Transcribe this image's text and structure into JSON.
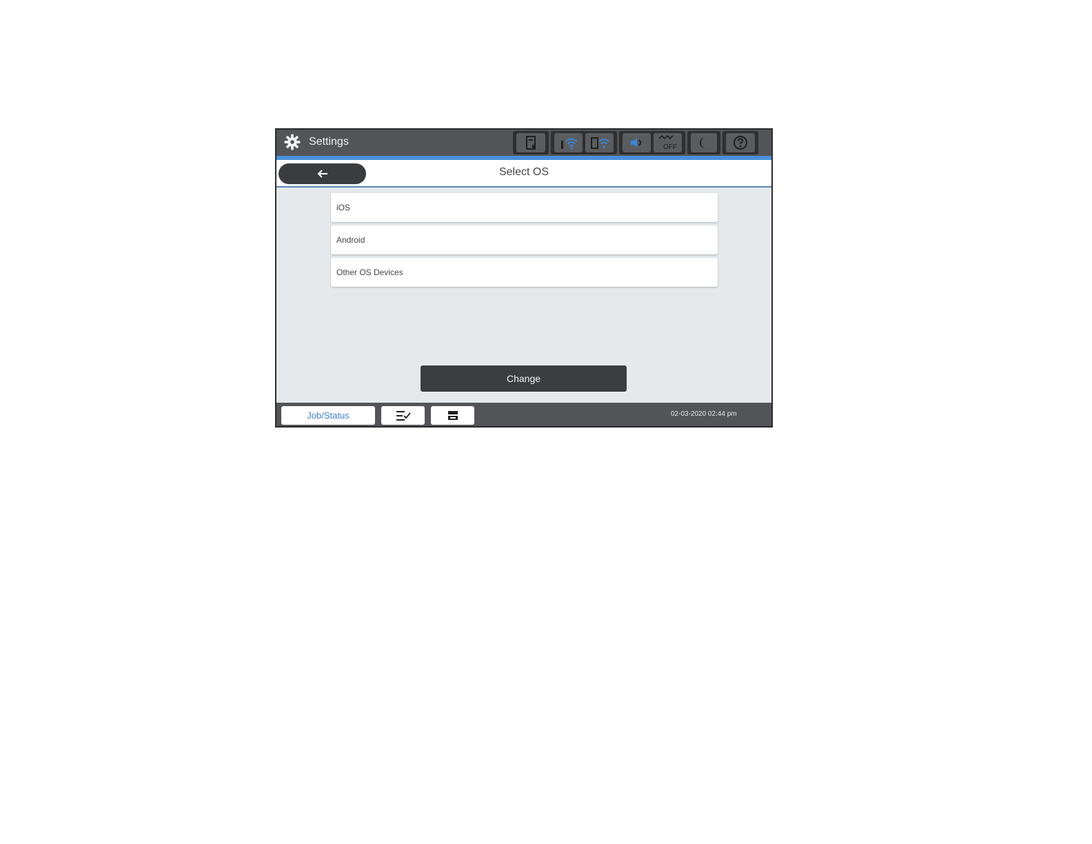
{
  "top_bar": {
    "title": "Settings",
    "icons": [
      "gear-icon",
      "printer-status-icon",
      "wifi-icon",
      "wifi-direct-icon",
      "sound-icon",
      "quiet-mode-off-icon",
      "sleep-icon",
      "help-icon"
    ],
    "quiet_mode_label": "OFF"
  },
  "header": {
    "back_icon": "arrow-left-icon",
    "title": "Select OS"
  },
  "os_options": [
    {
      "label": "iOS"
    },
    {
      "label": "Android"
    },
    {
      "label": "Other OS Devices"
    }
  ],
  "change_button": {
    "label": "Change"
  },
  "bottom_bar": {
    "job_status_label": "Job/Status",
    "preset_icon": "job-list-icon",
    "copy_icon": "print-tray-icon",
    "datetime": "02-03-2020 02:44 pm"
  },
  "colors": {
    "accent_blue": "#4a8fd9",
    "bar_gray": "#535457",
    "content_bg": "#e6e9ec",
    "dark_button": "#3c3d3f"
  }
}
